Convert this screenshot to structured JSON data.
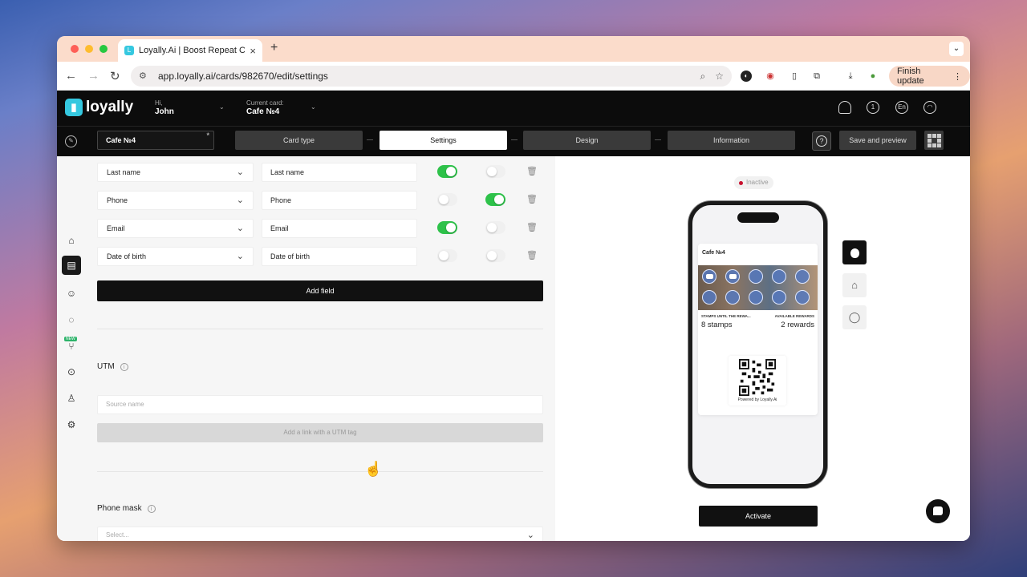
{
  "browser": {
    "tab_title": "Loyally.Ai | Boost Repeat Cus",
    "url": "app.loyally.ai/cards/982670/edit/settings",
    "finish_update": "Finish update"
  },
  "header": {
    "logo": "loyally",
    "greeting": "Hi,",
    "user": "John",
    "current_card_label": "Current card:",
    "current_card": "Cafe №4",
    "lang": "En"
  },
  "steps": {
    "card_name": "Cafe №4",
    "items": [
      "Card type",
      "Settings",
      "Design",
      "Information"
    ],
    "save": "Save and preview"
  },
  "fields": [
    {
      "type": "Last name",
      "label": "Last name",
      "toggle1": true,
      "toggle2": false
    },
    {
      "type": "Phone",
      "label": "Phone",
      "toggle1": false,
      "toggle2": true
    },
    {
      "type": "Email",
      "label": "Email",
      "toggle1": true,
      "toggle2": false
    },
    {
      "type": "Date of birth",
      "label": "Date of birth",
      "toggle1": false,
      "toggle2": false
    }
  ],
  "add_field": "Add field",
  "utm": {
    "title": "UTM",
    "placeholder": "Source name",
    "button": "Add a link with a UTM tag"
  },
  "phone_mask": {
    "title": "Phone mask",
    "placeholder": "Select..."
  },
  "preview": {
    "status": "Inactive",
    "card_name": "Cafe №4",
    "stamps_label": "STAMPS UNTIL THE REWA...",
    "stamps_value": "8 stamps",
    "rewards_label": "AVAILABLE REWARDS",
    "rewards_value": "2 rewards",
    "powered": "Powered by Loyally.Ai",
    "activate": "Activate",
    "stamps_filled": 2,
    "stamps_total": 10
  },
  "colors": {
    "accent": "#35c8e0",
    "toggle_on": "#2ec24a",
    "status_dot": "#c8102e"
  }
}
